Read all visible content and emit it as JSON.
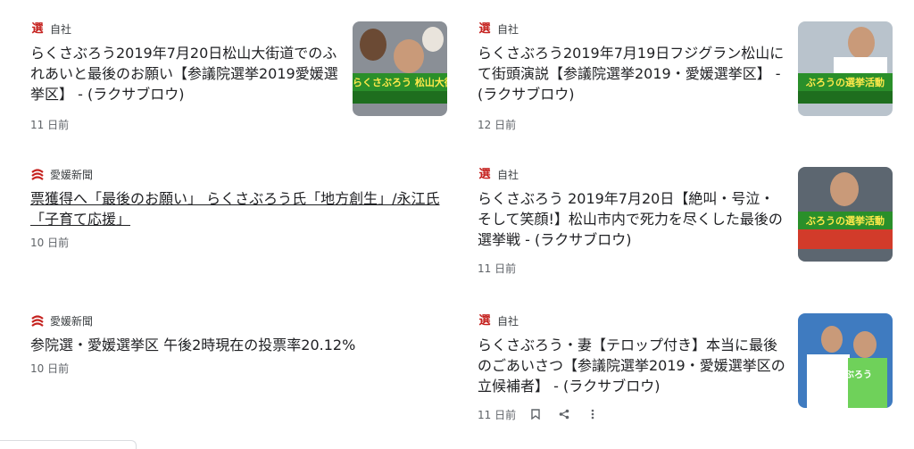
{
  "articles": [
    {
      "source": "自社",
      "source_icon": "選",
      "title": "らくさぶろう2019年7月20日松山大街道でのふれあいと最後のお願い【参議院選挙2019愛媛選挙区】 - (ラクサブロウ)",
      "time": "11 日前",
      "has_thumb": true
    },
    {
      "source": "自社",
      "source_icon": "選",
      "title": "らくさぶろう2019年7月19日フジグラン松山にて街頭演説【参議院選挙2019・愛媛選挙区】 - (ラクサブロウ)",
      "time": "12 日前",
      "has_thumb": true
    },
    {
      "source": "愛媛新聞",
      "title": "票獲得へ「最後のお願い」 らくさぶろう氏「地方創生」/永江氏「子育て応援」",
      "time": "10 日前"
    },
    {
      "source": "自社",
      "source_icon": "選",
      "title": "らくさぶろう 2019年7月20日【絶叫・号泣・そして笑顔!】松山市内で死力を尽くした最後の選挙戦 - (ラクサブロウ)",
      "time": "11 日前",
      "has_thumb": true
    },
    {
      "source": "愛媛新聞",
      "title": "参院選・愛媛選挙区 午後2時現在の投票率20.12%",
      "time": "10 日前"
    },
    {
      "source": "自社",
      "source_icon": "選",
      "title": "らくさぶろう・妻【テロップ付き】本当に最後のごあいさつ【参議院選挙2019・愛媛選挙区の立候補者】 - (ラクサブロウ)",
      "time": "11 日前",
      "has_thumb": true
    }
  ],
  "thumbs": {
    "t1": "らくさぶろう 松山大街道",
    "t2": "ぶろうの選挙活動",
    "t3": "ぶろうの選挙活動",
    "t4": "らくさぶろう"
  },
  "icons": {
    "bookmark": "bookmark-icon",
    "share": "share-icon",
    "more": "more-vert-icon"
  },
  "colors": {
    "accent_red": "#c5221f",
    "thumb_green": "#2a8f2a",
    "caption_yellow": "#ffe94a"
  }
}
